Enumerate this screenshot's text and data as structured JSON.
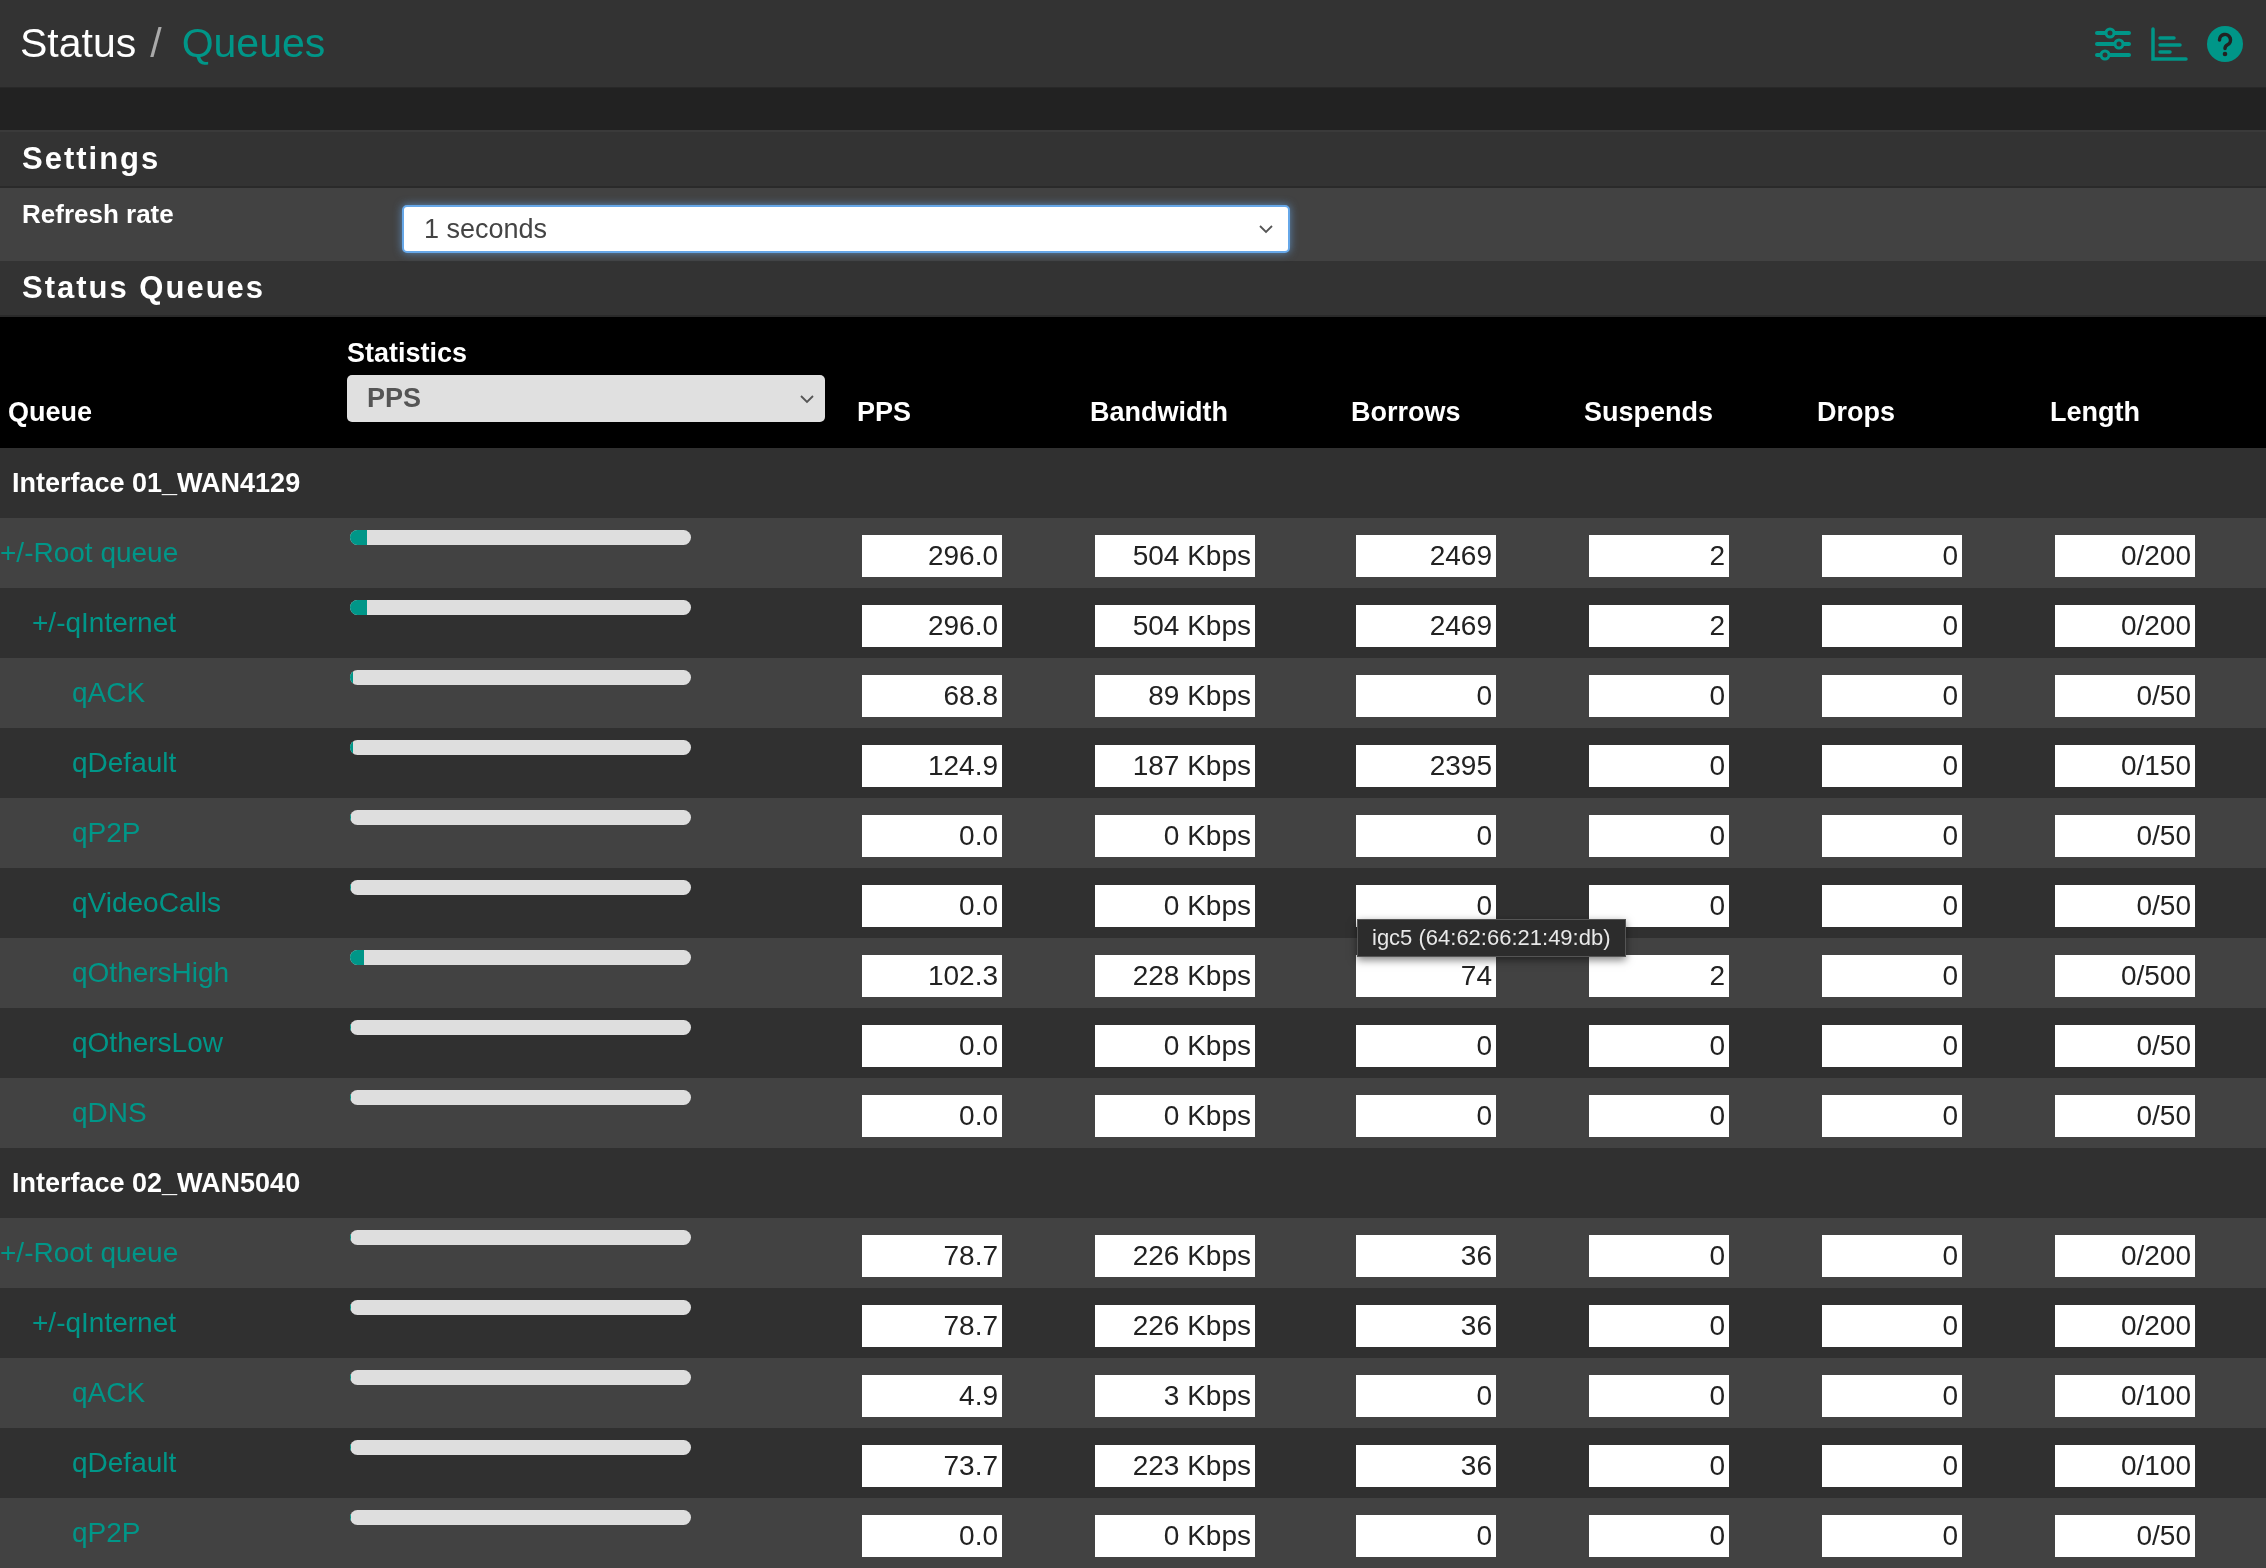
{
  "header": {
    "breadcrumb": [
      {
        "text": "Status",
        "kind": "plain"
      },
      {
        "text": "/",
        "kind": "separator"
      },
      {
        "text": "Queues",
        "kind": "link"
      }
    ]
  },
  "settings": {
    "title": "Settings",
    "refresh_label": "Refresh rate",
    "refresh_value": "1 seconds"
  },
  "status": {
    "title": "Status Queues",
    "statistics_label": "Statistics",
    "statistics_value": "PPS",
    "columns": [
      "Queue",
      "PPS",
      "Bandwidth",
      "Borrows",
      "Suspends",
      "Drops",
      "Length"
    ]
  },
  "interfaces": [
    {
      "name": "Interface 01_WAN4129",
      "queues": [
        {
          "name": "+/-Root queue",
          "level": 0.05,
          "values": [
            "296.0",
            "504 Kbps",
            "2469",
            "2",
            "0",
            "0/200"
          ],
          "children": [
            {
              "name": "+/-qInternet",
              "level": 0.05,
              "values": [
                "296.0",
                "504 Kbps",
                "2469",
                "2",
                "0",
                "0/200"
              ],
              "children": [
                {
                  "name": "qACK",
                  "level": 0.01,
                  "values": [
                    "68.8",
                    "89 Kbps",
                    "0",
                    "0",
                    "0",
                    "0/50"
                  ]
                },
                {
                  "name": "qDefault",
                  "level": 0.01,
                  "values": [
                    "124.9",
                    "187 Kbps",
                    "2395",
                    "0",
                    "0",
                    "0/150"
                  ]
                },
                {
                  "name": "qP2P",
                  "level": 0,
                  "values": [
                    "0.0",
                    "0 Kbps",
                    "0",
                    "0",
                    "0",
                    "0/50"
                  ]
                },
                {
                  "name": "qVideoCalls",
                  "level": 0,
                  "values": [
                    "0.0",
                    "0 Kbps",
                    "0",
                    "0",
                    "0",
                    "0/50"
                  ]
                },
                {
                  "name": "qOthersHigh",
                  "level": 0.04,
                  "values": [
                    "102.3",
                    "228 Kbps",
                    "74",
                    "2",
                    "0",
                    "0/500"
                  ]
                },
                {
                  "name": "qOthersLow",
                  "level": 0,
                  "values": [
                    "0.0",
                    "0 Kbps",
                    "0",
                    "0",
                    "0",
                    "0/50"
                  ]
                },
                {
                  "name": "qDNS",
                  "level": 0,
                  "values": [
                    "0.0",
                    "0 Kbps",
                    "0",
                    "0",
                    "0",
                    "0/50"
                  ]
                }
              ]
            }
          ]
        }
      ]
    },
    {
      "name": "Interface 02_WAN5040",
      "queues": [
        {
          "name": "+/-Root queue",
          "level": 0,
          "values": [
            "78.7",
            "226 Kbps",
            "36",
            "0",
            "0",
            "0/200"
          ],
          "children": [
            {
              "name": "+/-qInternet",
              "level": 0,
              "values": [
                "78.7",
                "226 Kbps",
                "36",
                "0",
                "0",
                "0/200"
              ],
              "children": [
                {
                  "name": "qACK",
                  "level": 0,
                  "values": [
                    "4.9",
                    "3 Kbps",
                    "0",
                    "0",
                    "0",
                    "0/100"
                  ]
                },
                {
                  "name": "qDefault",
                  "level": 0,
                  "values": [
                    "73.7",
                    "223 Kbps",
                    "36",
                    "0",
                    "0",
                    "0/100"
                  ]
                },
                {
                  "name": "qP2P",
                  "level": 0,
                  "values": [
                    "0.0",
                    "0 Kbps",
                    "0",
                    "0",
                    "0",
                    "0/50"
                  ]
                }
              ]
            }
          ]
        }
      ]
    }
  ],
  "tooltip": {
    "text": "igc5 (64:62:66:21:49:db)"
  }
}
